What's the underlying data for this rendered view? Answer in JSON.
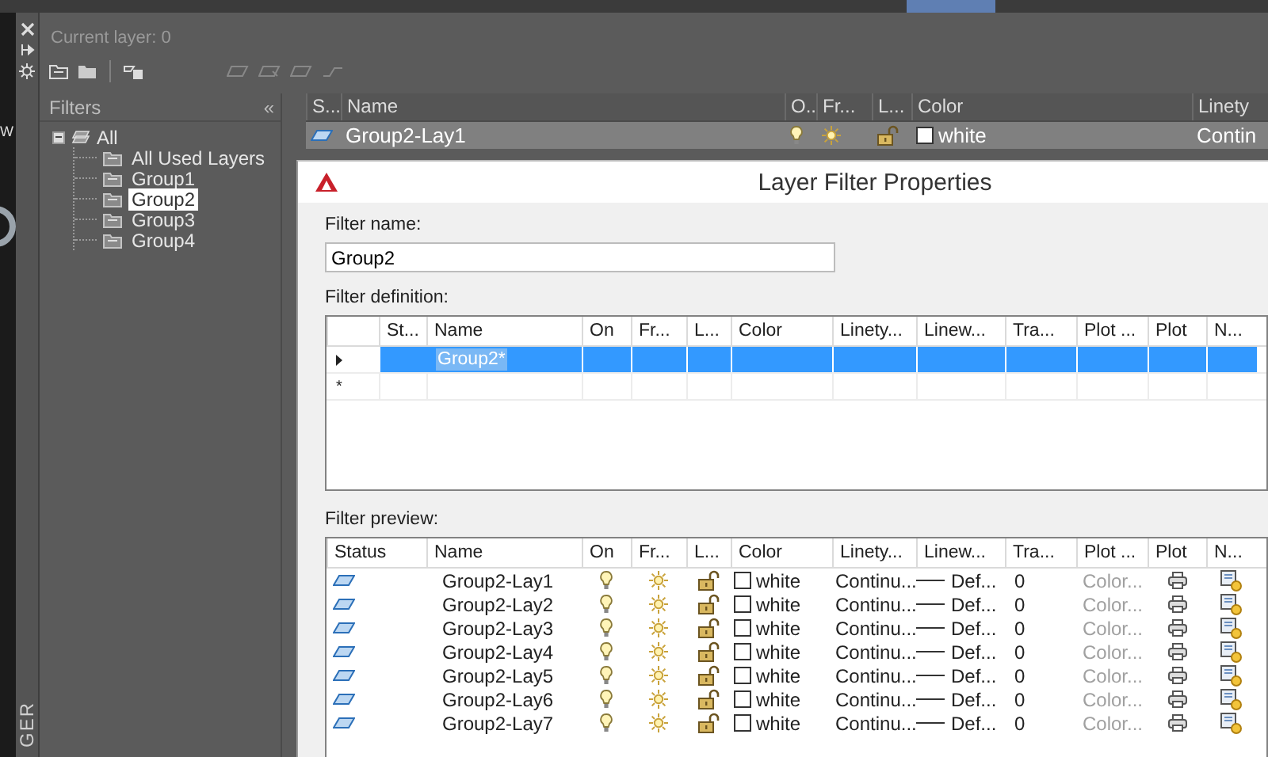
{
  "desktop": {
    "edge_text": "W"
  },
  "palette": {
    "side_title": "GER",
    "current_layer": "Current layer: 0",
    "filters_title": "Filters",
    "collapse": "«"
  },
  "filter_tree": {
    "label": "All",
    "expanded": true,
    "children": [
      {
        "label": "All Used Layers",
        "selected": false
      },
      {
        "label": "Group1",
        "selected": false
      },
      {
        "label": "Group2",
        "selected": true
      },
      {
        "label": "Group3",
        "selected": false
      },
      {
        "label": "Group4",
        "selected": false
      }
    ]
  },
  "layer_list": {
    "columns": [
      "S...",
      "Name",
      "O..",
      "Fr...",
      "L...",
      "Color",
      "Linety"
    ],
    "rows": [
      {
        "name": "Group2-Lay1",
        "selected": true,
        "on": true,
        "frozen": false,
        "locked": false,
        "color_name": "white",
        "linetype": "Contin"
      }
    ]
  },
  "dialog": {
    "title": "Layer Filter Properties",
    "filter_name_label": "Filter name:",
    "filter_name": "Group2",
    "definition_label": "Filter definition:",
    "definition_columns": [
      "St...",
      "Name",
      "On",
      "Fr...",
      "L...",
      "Color",
      "Linety...",
      "Linew...",
      "Tra...",
      "Plot ...",
      "Plot",
      "N..."
    ],
    "definition_rows": [
      {
        "kind": "current",
        "name": "Group2*",
        "selected": true
      },
      {
        "kind": "new",
        "marker": "*",
        "selected": false
      }
    ],
    "preview_label": "Filter preview:",
    "preview_columns": [
      "Status",
      "Name",
      "On",
      "Fr...",
      "L...",
      "Color",
      "Linety...",
      "Linew...",
      "Tra...",
      "Plot ...",
      "Plot",
      "N..."
    ],
    "preview_rows": [
      {
        "name": "Group2-Lay1",
        "on": true,
        "frozen": false,
        "locked": false,
        "color_name": "white",
        "linetype": "Continu...",
        "lineweight": "Def...",
        "transparency": "0",
        "plot_style": "Color...",
        "plot": true
      },
      {
        "name": "Group2-Lay2",
        "on": true,
        "frozen": false,
        "locked": false,
        "color_name": "white",
        "linetype": "Continu...",
        "lineweight": "Def...",
        "transparency": "0",
        "plot_style": "Color...",
        "plot": true
      },
      {
        "name": "Group2-Lay3",
        "on": true,
        "frozen": false,
        "locked": false,
        "color_name": "white",
        "linetype": "Continu...",
        "lineweight": "Def...",
        "transparency": "0",
        "plot_style": "Color...",
        "plot": true
      },
      {
        "name": "Group2-Lay4",
        "on": true,
        "frozen": false,
        "locked": false,
        "color_name": "white",
        "linetype": "Continu...",
        "lineweight": "Def...",
        "transparency": "0",
        "plot_style": "Color...",
        "plot": true
      },
      {
        "name": "Group2-Lay5",
        "on": true,
        "frozen": false,
        "locked": false,
        "color_name": "white",
        "linetype": "Continu...",
        "lineweight": "Def...",
        "transparency": "0",
        "plot_style": "Color...",
        "plot": true
      },
      {
        "name": "Group2-Lay6",
        "on": true,
        "frozen": false,
        "locked": false,
        "color_name": "white",
        "linetype": "Continu...",
        "lineweight": "Def...",
        "transparency": "0",
        "plot_style": "Color...",
        "plot": true
      },
      {
        "name": "Group2-Lay7",
        "on": true,
        "frozen": false,
        "locked": false,
        "color_name": "white",
        "linetype": "Continu...",
        "lineweight": "Def...",
        "transparency": "0",
        "plot_style": "Color...",
        "plot": true
      }
    ]
  }
}
